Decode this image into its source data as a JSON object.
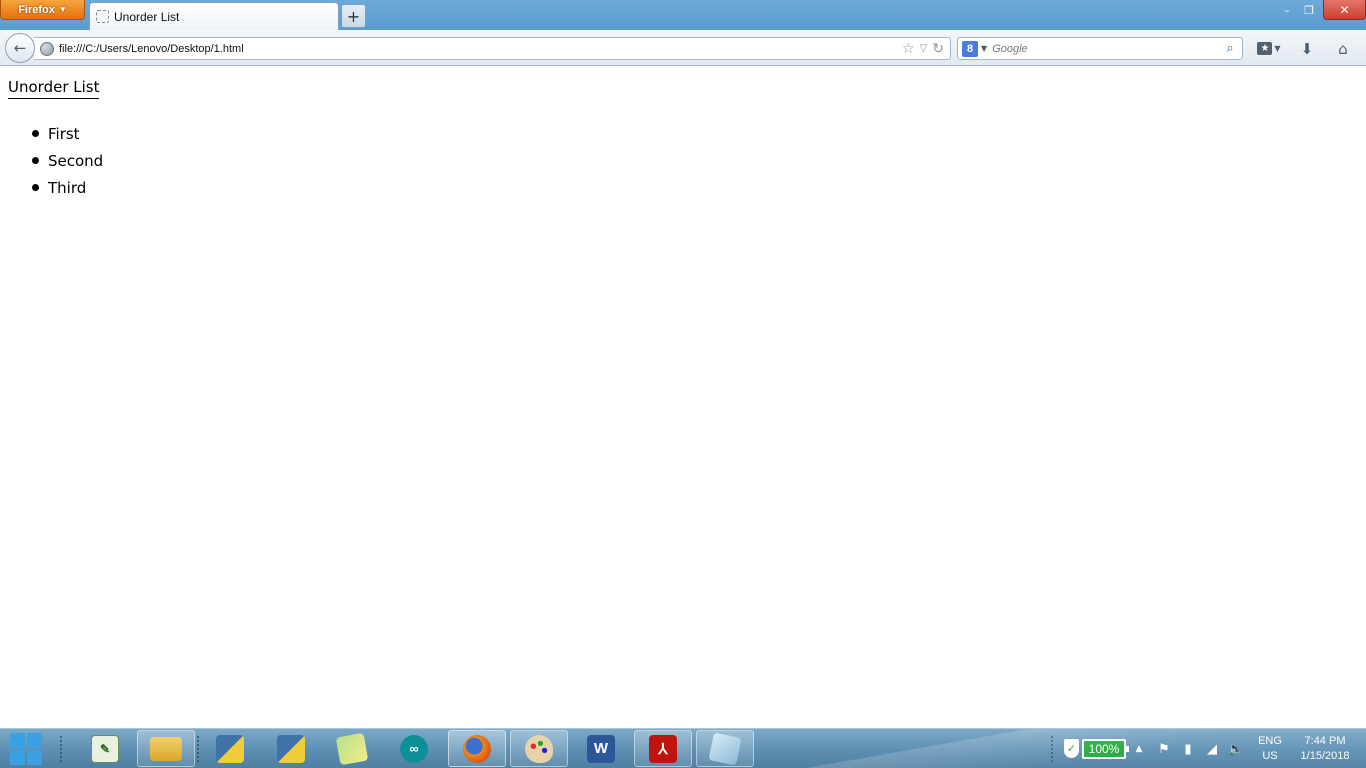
{
  "browser": {
    "menu_button_label": "Firefox",
    "tab": {
      "title": "Unorder List"
    },
    "new_tab_label": "+",
    "window_controls": {
      "minimize": "–",
      "restore": "❐",
      "close": "✕"
    },
    "address": "file:///C:/Users/Lenovo/Desktop/1.html",
    "search": {
      "placeholder": "Google",
      "engine_icon": "google-icon"
    }
  },
  "page": {
    "heading": "Unorder List",
    "items": [
      "First",
      "Second",
      "Third"
    ]
  },
  "taskbar": {
    "apps": [
      {
        "name": "notepad-plus",
        "color": "#3b7c2a"
      },
      {
        "name": "file-explorer",
        "color": "#e2b53b"
      },
      {
        "name": "python-idle",
        "color": "#3f73a8"
      },
      {
        "name": "python-idle-2",
        "color": "#3f73a8"
      },
      {
        "name": "sticky-notes",
        "color": "#e9e17a"
      },
      {
        "name": "arduino",
        "color": "#0c8f96"
      },
      {
        "name": "firefox",
        "color": "#e66000"
      },
      {
        "name": "paint",
        "color": "#c9a46b"
      },
      {
        "name": "word",
        "color": "#2b579a"
      },
      {
        "name": "acrobat",
        "color": "#c0150e"
      },
      {
        "name": "notepad",
        "color": "#9bc7e0"
      }
    ],
    "battery_percent": "100%",
    "language_line1": "ENG",
    "language_line2": "US",
    "time": "7:44 PM",
    "date": "1/15/2018"
  },
  "colors": {
    "titlebar": "#5b9ccf",
    "firefox_orange": "#e3720f",
    "close_red": "#c9412f",
    "taskbar": "#5d8fb2",
    "battery_green": "#1fa83a"
  }
}
